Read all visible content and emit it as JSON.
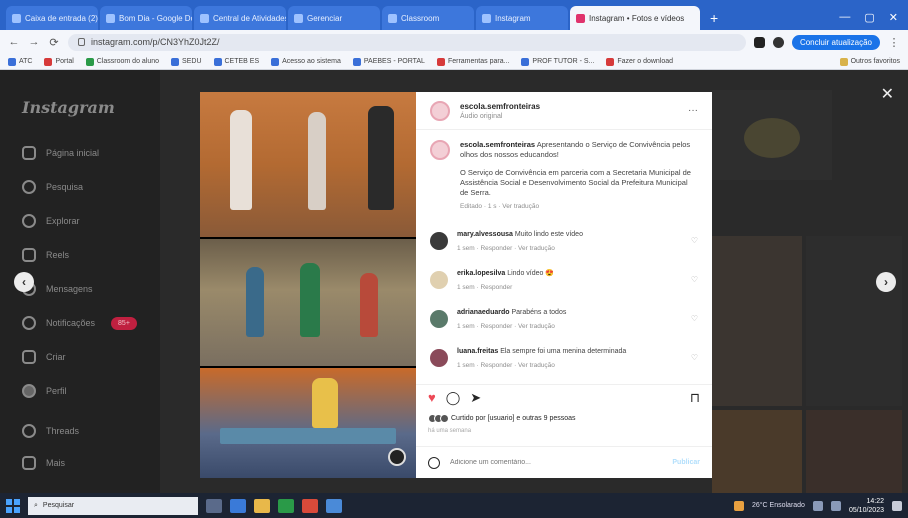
{
  "browser": {
    "tabs": [
      {
        "label": "Caixa de entrada (2)"
      },
      {
        "label": "Bom Dia - Google Doc"
      },
      {
        "label": "Central de Atividades"
      },
      {
        "label": "Gerenciar"
      },
      {
        "label": "Classroom"
      },
      {
        "label": "Instagram"
      }
    ],
    "active_tab_label": "Instagram • Fotos e vídeos",
    "new_tab": "+",
    "window_controls": {
      "minimize": "—",
      "maximize": "▢",
      "close": "✕"
    },
    "address": "instagram.com/p/CN3YhZ0Jt2Z/",
    "nav": {
      "back": "←",
      "forward": "→",
      "reload": "⟳",
      "home": "⌂"
    },
    "profile_label": "Concluir atualização"
  },
  "bookmarks": [
    {
      "label": "ATC"
    },
    {
      "label": "Portal"
    },
    {
      "label": "Classroom do aluno"
    },
    {
      "label": "SEDU"
    },
    {
      "label": "CETEB ES"
    },
    {
      "label": "Acesso ao sistema"
    },
    {
      "label": "PAEBES - PORTAL"
    },
    {
      "label": "Ferramentas para..."
    },
    {
      "label": "PROF TUTOR - S..."
    },
    {
      "label": "Fazer o download"
    },
    {
      "label": "Outros favoritos"
    }
  ],
  "sidebar": {
    "logo": "Instagram",
    "items": [
      {
        "label": "Página inicial"
      },
      {
        "label": "Pesquisa"
      },
      {
        "label": "Explorar"
      },
      {
        "label": "Reels"
      },
      {
        "label": "Mensagens"
      },
      {
        "label": "Notificações",
        "badge": "85+"
      },
      {
        "label": "Criar"
      },
      {
        "label": "Perfil"
      },
      {
        "label": "Threads"
      },
      {
        "label": "Mais"
      }
    ]
  },
  "modal": {
    "close": "✕",
    "prev": "‹",
    "next": "›",
    "account": {
      "name": "escola.semfronteiras",
      "subtitle": "Áudio original"
    },
    "caption": {
      "author": "escola.semfronteiras",
      "text": "Apresentando o Serviço de Convivência pelos olhos dos nossos educandos!",
      "text2": "O Serviço de Convivência em parceria com a Secretaria Municipal de Assistência Social e Desenvolvimento Social da Prefeitura Municipal de Serra.",
      "meta": "Editado · 1 s · Ver tradução"
    },
    "comments": [
      {
        "author": "mary.alvessousa",
        "text": "Muito lindo este vídeo",
        "meta": "1 sem · Responder · Ver tradução"
      },
      {
        "author": "erika.lopesilva",
        "text": "Lindo vídeo 😍",
        "meta": "1 sem · Responder"
      },
      {
        "author": "adrianaeduardo",
        "text": "Parabéns a todos",
        "meta": "1 sem · Responder · Ver tradução"
      },
      {
        "author": "luana.freitas",
        "text": "Ela sempre foi uma menina determinada",
        "meta": "1 sem · Responder · Ver tradução"
      }
    ],
    "actions": {
      "like": "♥",
      "comment": "◯",
      "share": "➤",
      "save": "⊓"
    },
    "likes_text": "Curtido por [usuario] e outras 9 pessoas",
    "date": "há uma semana",
    "comment_placeholder": "Adicione um comentário...",
    "publish": "Publicar"
  },
  "taskbar": {
    "search_placeholder": "Pesquisar",
    "weather": "26°C Ensolarado",
    "time": "14:22",
    "date": "05/10/2023"
  },
  "colors": {
    "chrome_blue": "#2b64c8",
    "ig_red": "#ed4956",
    "badge_red": "#c02040"
  }
}
